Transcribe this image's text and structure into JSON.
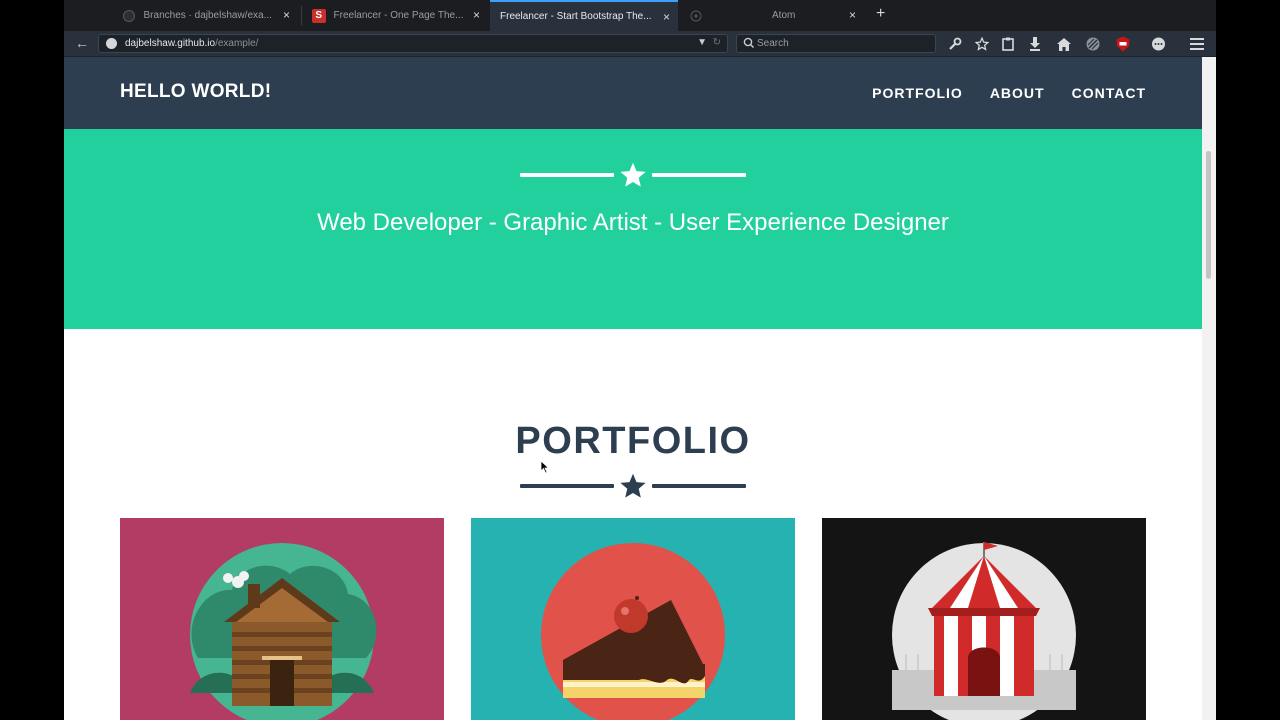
{
  "browser": {
    "tabs": [
      {
        "title": "Branches · dajbelshaw/exa...",
        "favicon": "github-icon",
        "active": false
      },
      {
        "title": "Freelancer - One Page The...",
        "favicon": "startbootstrap-icon",
        "active": false
      },
      {
        "title": "Freelancer - Start Bootstrap The...",
        "favicon": "none",
        "active": true
      },
      {
        "title": "Atom",
        "favicon": "atom-icon",
        "active": false
      }
    ],
    "close_glyph": "×",
    "new_tab_glyph": "+",
    "url_host": "dajbelshaw.github.io",
    "url_path": "/example/",
    "search_placeholder": "Search",
    "toolbar_icons": [
      "wrench-icon",
      "star-bookmark-icon",
      "clipboard-icon",
      "download-icon",
      "home-icon",
      "privacy-icon",
      "ublock-icon",
      "chat-icon",
      "hamburger-menu-icon"
    ]
  },
  "site": {
    "brand": "HELLO WORLD!",
    "nav": [
      "PORTFOLIO",
      "ABOUT",
      "CONTACT"
    ],
    "tagline": "Web Developer - Graphic Artist - User Experience Designer",
    "portfolio_title": "PORTFOLIO",
    "portfolio_items": [
      {
        "name": "cabin",
        "bg": "#b23c63"
      },
      {
        "name": "cake",
        "bg": "#27b2b2"
      },
      {
        "name": "circus",
        "bg": "#141414"
      }
    ],
    "colors": {
      "nav_bg": "#2c3e50",
      "hero_bg": "#22d09e",
      "title": "#2c3e50"
    }
  }
}
